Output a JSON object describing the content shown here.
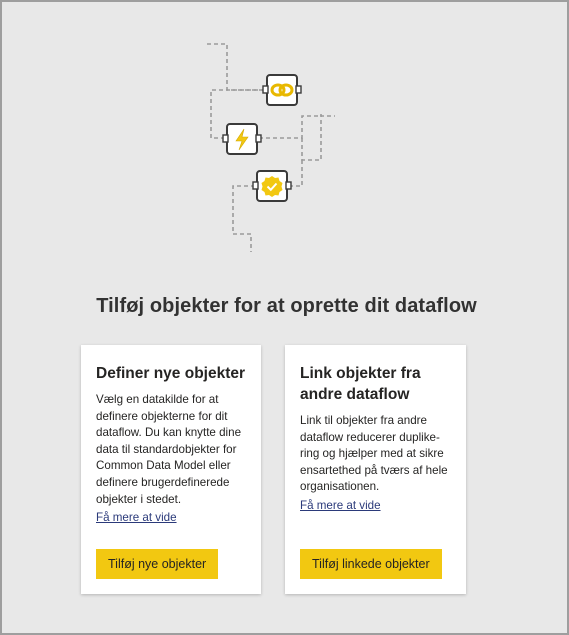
{
  "colors": {
    "accent": "#f2c811",
    "background": "#e8e8e8",
    "link": "#2b3a7a",
    "text": "#252423"
  },
  "illustration": {
    "nodes": [
      "link-icon",
      "lightning-icon",
      "checkmark-badge-icon"
    ]
  },
  "heading": "Tilføj objekter for at oprette dit dataflow",
  "cards": [
    {
      "title": "Definer nye objekter",
      "body": "Vælg en datakilde for at definere objekterne for dit dataflow. Du kan knytte dine data til standardobjekter for Common Data Model eller definere brugerdefinerede objekter i stedet.",
      "link": "Få mere at vide",
      "button": "Tilføj nye objekter"
    },
    {
      "title": "Link objekter fra andre dataflow",
      "body": "Link til objekter fra andre dataflow reducerer duplike­ring og hjælper med at sikre ensartethed på tværs af hele organisationen.",
      "link": "Få mere at vide",
      "button": "Tilføj linkede objekter"
    }
  ]
}
